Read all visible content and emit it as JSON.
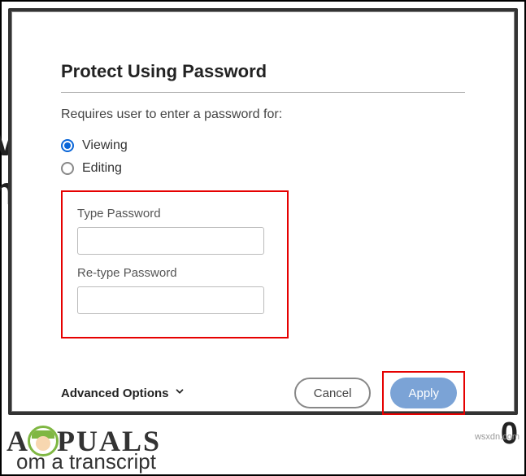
{
  "dialog": {
    "title": "Protect Using Password",
    "subtitle": "Requires user to enter a password for:",
    "radios": {
      "viewing": {
        "label": "Viewing",
        "checked": true
      },
      "editing": {
        "label": "Editing",
        "checked": false
      }
    },
    "fields": {
      "password_label": "Type Password",
      "password_value": "",
      "retype_label": "Re-type Password",
      "retype_value": ""
    },
    "advanced_label": "Advanced Options",
    "buttons": {
      "cancel": "Cancel",
      "apply": "Apply"
    }
  },
  "watermark": {
    "brand_prefix": "A",
    "brand_suffix": "PUALS",
    "credit": "wsxdn.com"
  },
  "bg": {
    "bottom_text": "om a transcript",
    "zero": "0"
  }
}
